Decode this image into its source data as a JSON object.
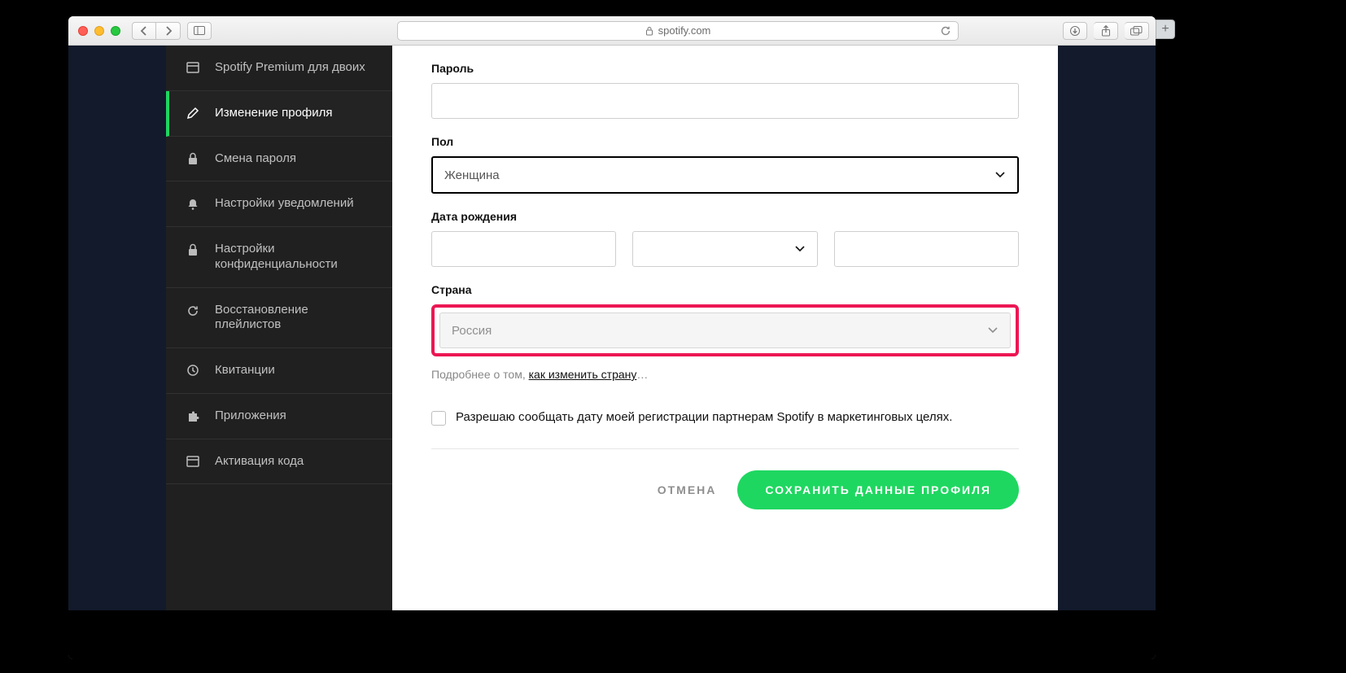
{
  "browser": {
    "domain": "spotify.com"
  },
  "sidebar": {
    "items": [
      {
        "label": "Spotify Premium для двоих",
        "icon": "card"
      },
      {
        "label": "Изменение профиля",
        "icon": "pencil",
        "active": true
      },
      {
        "label": "Смена пароля",
        "icon": "lock"
      },
      {
        "label": "Настройки уведомлений",
        "icon": "bell"
      },
      {
        "label": "Настройки конфиденциальности",
        "icon": "lock"
      },
      {
        "label": "Восстановление плейлистов",
        "icon": "refresh"
      },
      {
        "label": "Квитанции",
        "icon": "clock"
      },
      {
        "label": "Приложения",
        "icon": "puzzle"
      },
      {
        "label": "Активация кода",
        "icon": "card"
      }
    ]
  },
  "form": {
    "password_label": "Пароль",
    "gender_label": "Пол",
    "gender_value": "Женщина",
    "dob_label": "Дата рождения",
    "country_label": "Страна",
    "country_value": "Россия",
    "help_prefix": "Подробнее о том, ",
    "help_link": "как изменить страну",
    "help_suffix": "…",
    "consent_text": "Разрешаю сообщать дату моей регистрации партнерам Spotify в маркетинговых целях.",
    "cancel": "ОТМЕНА",
    "save": "СОХРАНИТЬ ДАННЫЕ ПРОФИЛЯ"
  }
}
